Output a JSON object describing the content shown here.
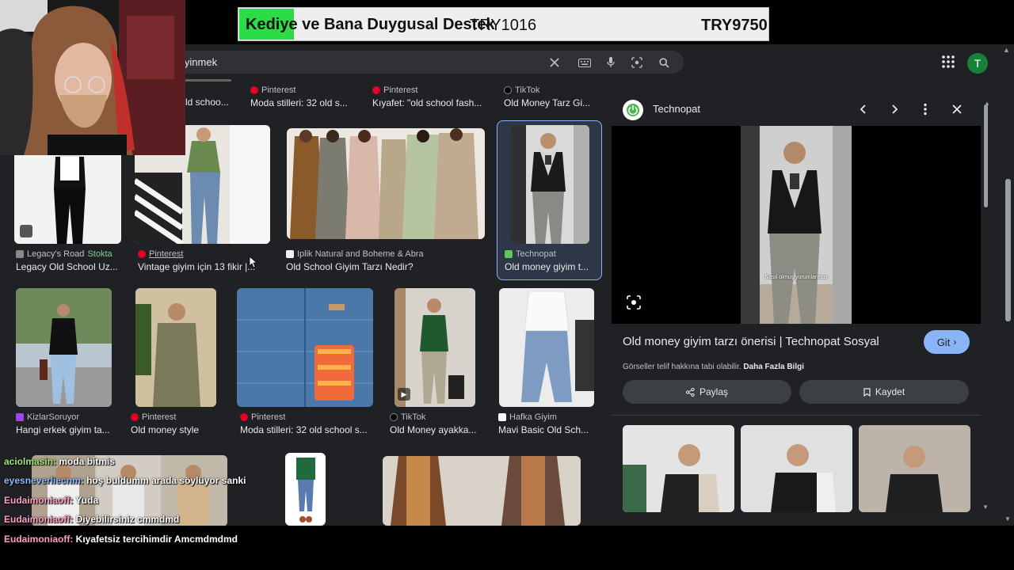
{
  "search": {
    "query_visible": "iyinmek"
  },
  "top_row": [
    {
      "source": "",
      "title": "ld schoo..."
    },
    {
      "source": "Pinterest",
      "title": "Moda stilleri: 32 old s..."
    },
    {
      "source": "Pinterest",
      "title": "Kıyafet: \"old school fash..."
    },
    {
      "source": "TikTok",
      "title": "Old Money Tarz Gi..."
    }
  ],
  "row1": [
    {
      "source": "Legacy's Road",
      "badge": "Stokta",
      "title": "Legacy Old School Uz..."
    },
    {
      "source": "Pinterest",
      "title": "Vintage giyim için 13 fikir |..."
    },
    {
      "source": "Iplik Natural and Boheme & Abra",
      "title": "Old School Giyim Tarzı Nedir?"
    },
    {
      "source": "Technopat",
      "title": "Old money giyim t..."
    }
  ],
  "row2": [
    {
      "source": "KizlarSoruyor",
      "title": "Hangi erkek giyim ta..."
    },
    {
      "source": "Pinterest",
      "title": "Old money style"
    },
    {
      "source": "Pinterest",
      "title": "Moda stilleri: 32 old school s..."
    },
    {
      "source": "TikTok",
      "title": "Old Money ayakka..."
    },
    {
      "source": "Hafka Giyim",
      "title": "Mavi Basic Old Sch..."
    }
  ],
  "panel": {
    "site": "Technopat",
    "caption": "Nasıl olmuş yorumlarınızı",
    "title": "Old money giyim tarzı önerisi | Technopat Sosyal",
    "go_label": "Git",
    "copyright": "Görseller telif hakkına tabi olabilir.",
    "more_info": "Daha Fazla Bilgi",
    "share_label": "Paylaş",
    "save_label": "Kaydet"
  },
  "avatar_letter": "T",
  "price_bar": {
    "left_text": "Kediye ve Bana Duygusal Destek",
    "mid_text": "TRY1016",
    "right_text": "TRY9750",
    "progress": 0.104
  },
  "chat": [
    {
      "user": "aciolmasin:",
      "msg": "moda bitmis",
      "color": "#9fe870"
    },
    {
      "user": "eyesneverliecnm:",
      "msg": "hoş buldumm arada söylüyor sanki",
      "color": "#8fb8ff"
    },
    {
      "user": "Eudaimoniaoff:",
      "msg": "Yuda",
      "color": "#ff9ec8"
    },
    {
      "user": "Eudaimoniaoff:",
      "msg": "Diyebilirsiniz cmmdmd",
      "color": "#ff9ec8"
    },
    {
      "user": "Eudaimoniaoff:",
      "msg": "Kıyafetsiz tercihimdir Amcmdmdmd",
      "color": "#ff9ec8"
    }
  ],
  "colors": {
    "page_bg": "#202124",
    "accent_blue": "#8ab4f8",
    "progress_green": "#2bdc47",
    "pinterest_red": "#e60023",
    "technopat_green": "#5ac85a"
  }
}
